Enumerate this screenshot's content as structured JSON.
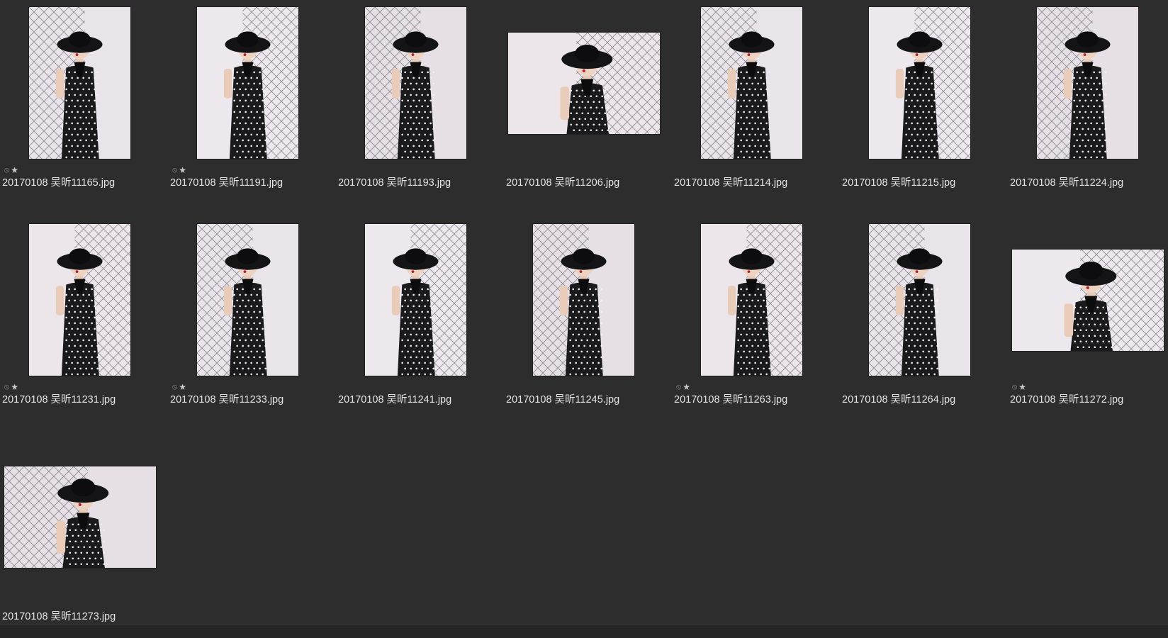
{
  "theme": {
    "background": "#2d2d2d",
    "text": "#e4e4e4",
    "icon": "#9a9a9a"
  },
  "icons": {
    "no_entry": "⃠",
    "star": "★"
  },
  "items": [
    {
      "filename": "20170108 吴昕11165.jpg",
      "orientation": "portrait",
      "tagged": true
    },
    {
      "filename": "20170108 吴昕11191.jpg",
      "orientation": "portrait",
      "tagged": true
    },
    {
      "filename": "20170108 吴昕11193.jpg",
      "orientation": "portrait",
      "tagged": false
    },
    {
      "filename": "20170108 吴昕11206.jpg",
      "orientation": "landscape",
      "tagged": false
    },
    {
      "filename": "20170108 吴昕11214.jpg",
      "orientation": "portrait",
      "tagged": false
    },
    {
      "filename": "20170108 吴昕11215.jpg",
      "orientation": "portrait",
      "tagged": false
    },
    {
      "filename": "20170108 吴昕11224.jpg",
      "orientation": "portrait",
      "tagged": false
    },
    {
      "filename": "20170108 吴昕11231.jpg",
      "orientation": "portrait",
      "tagged": true
    },
    {
      "filename": "20170108 吴昕11233.jpg",
      "orientation": "portrait",
      "tagged": true
    },
    {
      "filename": "20170108 吴昕11241.jpg",
      "orientation": "portrait",
      "tagged": false
    },
    {
      "filename": "20170108 吴昕11245.jpg",
      "orientation": "portrait",
      "tagged": false
    },
    {
      "filename": "20170108 吴昕11263.jpg",
      "orientation": "portrait",
      "tagged": true
    },
    {
      "filename": "20170108 吴昕11264.jpg",
      "orientation": "portrait",
      "tagged": false
    },
    {
      "filename": "20170108 吴昕11272.jpg",
      "orientation": "landscape",
      "tagged": true
    },
    {
      "filename": "20170108 吴昕11273.jpg",
      "orientation": "landscape",
      "tagged": false
    }
  ]
}
